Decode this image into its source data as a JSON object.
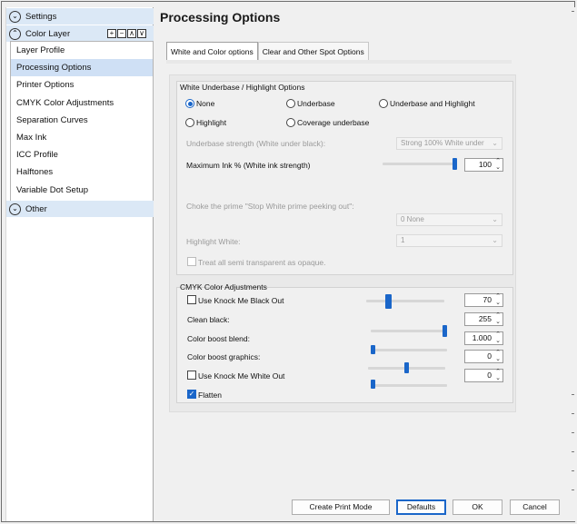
{
  "sidebar": {
    "settings_label": "Settings",
    "color_layer_label": "Color Layer",
    "tool_icons": [
      "+",
      "−",
      "∧",
      "∨"
    ],
    "items": [
      {
        "label": "Layer Profile",
        "selected": false
      },
      {
        "label": "Processing Options",
        "selected": true
      },
      {
        "label": "Printer Options",
        "selected": false
      },
      {
        "label": "CMYK Color Adjustments",
        "selected": false
      },
      {
        "label": "Separation Curves",
        "selected": false
      },
      {
        "label": "Max Ink",
        "selected": false
      },
      {
        "label": "ICC Profile",
        "selected": false
      },
      {
        "label": "Halftones",
        "selected": false
      },
      {
        "label": "Variable Dot Setup",
        "selected": false
      }
    ],
    "other_label": "Other"
  },
  "page": {
    "title": "Processing Options"
  },
  "tabs": [
    {
      "label": "White and Color options",
      "active": true
    },
    {
      "label": "Clear and Other Spot Options",
      "active": false
    }
  ],
  "white_group": {
    "title": "White Underbase / Highlight Options",
    "radios": [
      {
        "label": "None",
        "checked": true
      },
      {
        "label": "Underbase",
        "checked": false
      },
      {
        "label": "Underbase and Highlight",
        "checked": false
      },
      {
        "label": "Highlight",
        "checked": false
      },
      {
        "label": "Coverage underbase",
        "checked": false
      }
    ],
    "underbase_strength_label": "Underbase strength (White under black):",
    "underbase_strength_value": "Strong 100% White under",
    "max_ink_label": "Maximum Ink % (White ink strength)",
    "max_ink_value": "100",
    "max_ink_level": 1.0,
    "choke_label": "Choke the prime \"Stop White prime peeking out\":",
    "choke_value": "0 None",
    "highlight_white_label": "Highlight White:",
    "highlight_white_value": "1",
    "treat_label": "Treat all semi transparent as opaque."
  },
  "cmyk_group": {
    "title": "CMYK Color Adjustments",
    "knock_black_label": "Use Knock Me Black Out",
    "knock_black_value": "70",
    "knock_black_level": 0.27,
    "clean_black_label": "Clean black:",
    "clean_black_value": "255",
    "clean_black_level": 1.0,
    "boost_blend_label": "Color boost blend:",
    "boost_blend_value": "1.000",
    "boost_blend_level": 0.0,
    "boost_graphics_label": "Color boost graphics:",
    "boost_graphics_value": "0",
    "boost_graphics_level": 0.5,
    "knock_white_label": "Use Knock Me White Out",
    "knock_white_value": "0",
    "knock_white_level": 0.0,
    "flatten_label": "Flatten",
    "flatten_checked": true
  },
  "buttons": {
    "create": "Create Print Mode",
    "defaults": "Defaults",
    "ok": "OK",
    "cancel": "Cancel"
  },
  "colors": {
    "accent": "#1a66c9",
    "selected_row": "#cfe0f5",
    "section_header": "#dbe8f6"
  }
}
